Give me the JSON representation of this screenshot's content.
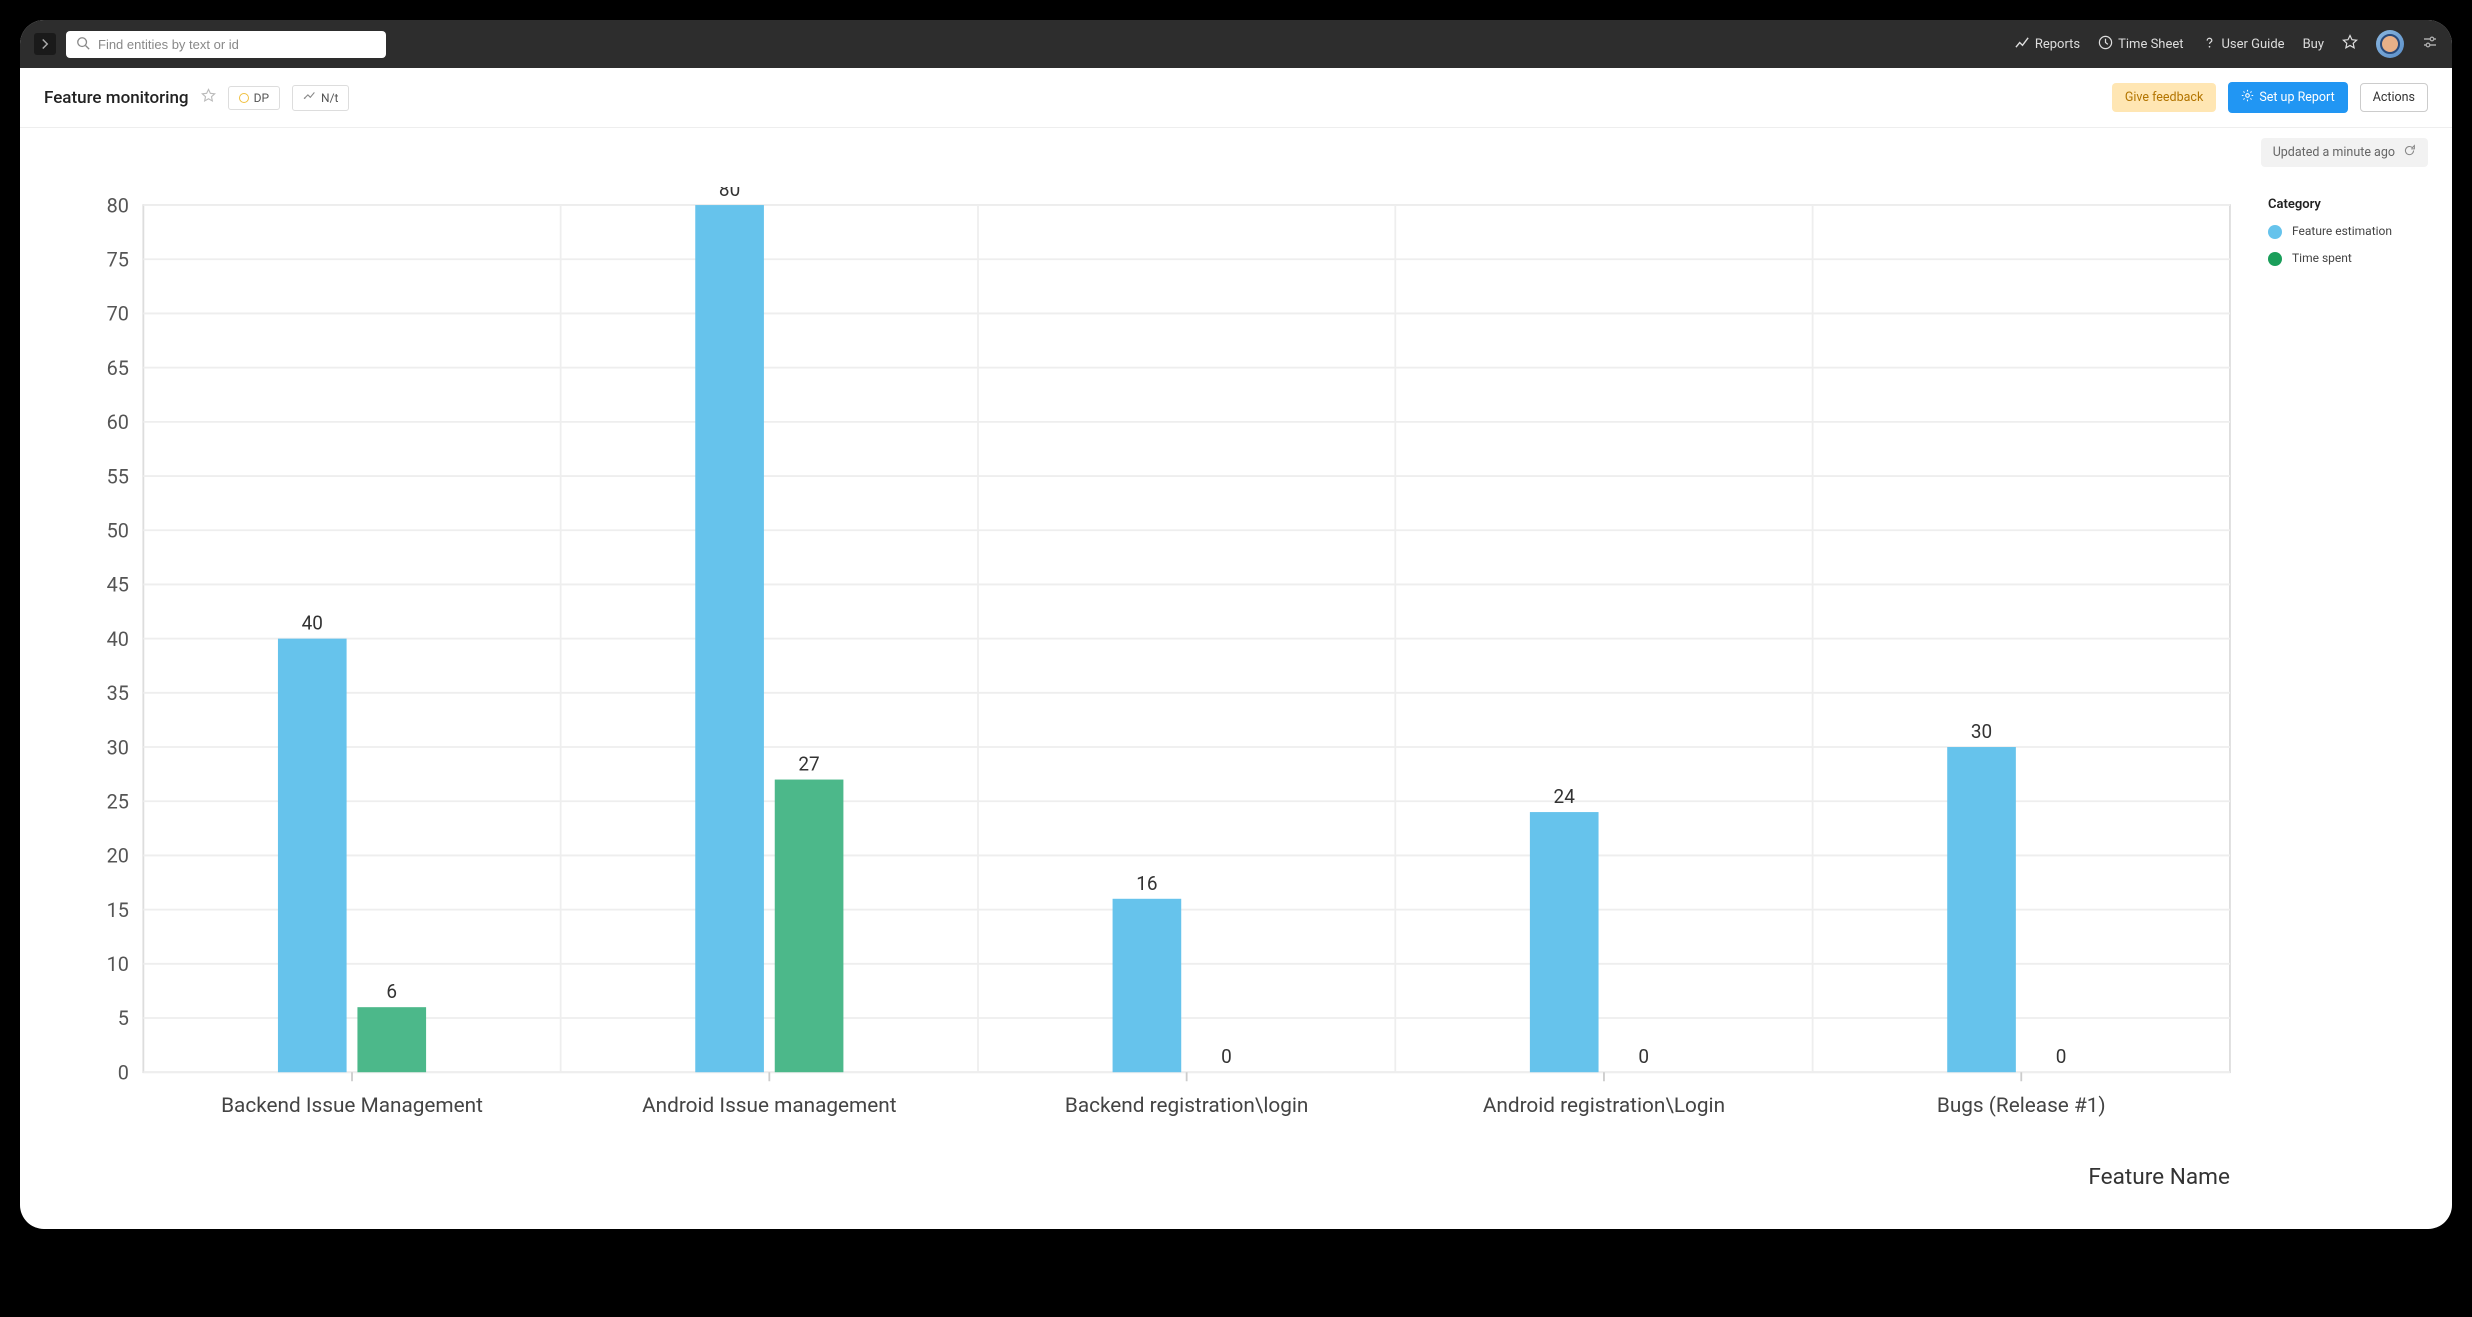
{
  "topbar": {
    "search_placeholder": "Find entities by text or id",
    "links": {
      "reports": "Reports",
      "timesheet": "Time Sheet",
      "userguide": "User Guide",
      "buy": "Buy"
    }
  },
  "page": {
    "title": "Feature monitoring",
    "tags": {
      "dp": "DP",
      "nt": "N/t"
    },
    "feedback_label": "Give feedback",
    "setup_label": "Set up Report",
    "actions_label": "Actions",
    "status_text": "Updated a minute ago"
  },
  "legend": {
    "title": "Category",
    "items": [
      {
        "label": "Feature estimation",
        "color": "#66c3ec"
      },
      {
        "label": "Time spent",
        "color": "#1a9e5a"
      }
    ]
  },
  "chart_xlabel": "Feature Name",
  "chart_data": {
    "type": "bar",
    "title": "",
    "xlabel": "Feature Name",
    "ylabel": "",
    "ylim": [
      0,
      80
    ],
    "yticks": [
      0,
      5,
      10,
      15,
      20,
      25,
      30,
      35,
      40,
      45,
      50,
      55,
      60,
      65,
      70,
      75,
      80
    ],
    "categories": [
      "Backend Issue Management",
      "Android Issue management",
      "Backend registration\\login",
      "Android registration\\Login",
      "Bugs (Release #1)"
    ],
    "series": [
      {
        "name": "Feature estimation",
        "color": "#66c3ec",
        "values": [
          40,
          80,
          16,
          24,
          30
        ]
      },
      {
        "name": "Time spent",
        "color": "#4cb88a",
        "values": [
          6,
          27,
          0,
          0,
          0
        ]
      }
    ]
  }
}
